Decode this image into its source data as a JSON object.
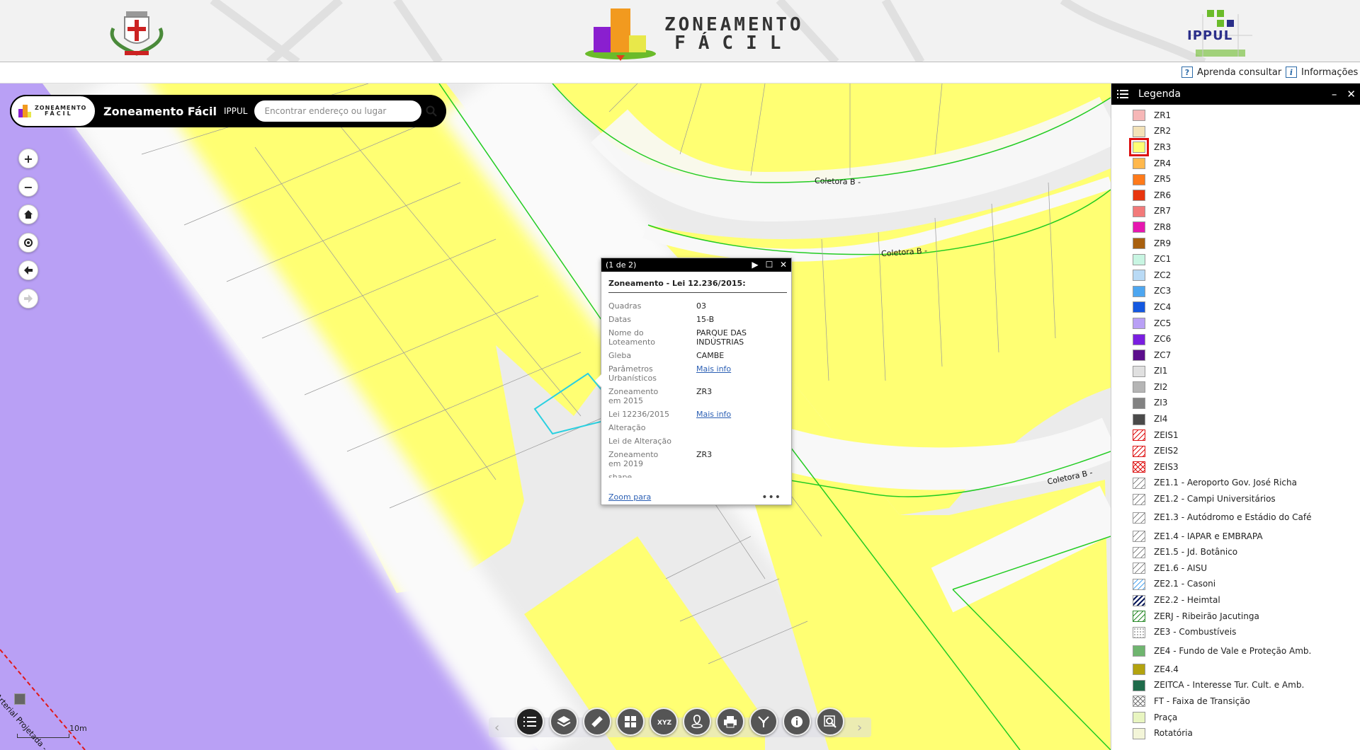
{
  "banner": {
    "title_line1": "ZONEAMENTO",
    "title_line2": "FÁCIL",
    "logo_right": "IPPUL"
  },
  "toolbar": {
    "learn_label": "Aprenda consultar",
    "info_label": "Informações"
  },
  "searchbar": {
    "logo_line1": "ZONEAMENTO",
    "logo_line2": "FÁCIL",
    "title": "Zoneamento Fácil",
    "subtitle": "IPPUL",
    "placeholder": "Encontrar endereço ou lugar"
  },
  "map": {
    "road_labels": [
      "Coletora B -",
      "Coletora B -",
      "Coletora B -",
      "Arterial Projetada -"
    ],
    "scale_label": "10m"
  },
  "popup": {
    "counter": "(1 de 2)",
    "title": "Zoneamento - Lei 12.236/2015:",
    "rows": [
      {
        "key": "Quadras",
        "value": "03"
      },
      {
        "key": "Datas",
        "value": "15-B"
      },
      {
        "key": "Nome do Loteamento",
        "value": "PARQUE DAS INDÚSTRIAS"
      },
      {
        "key": "Gleba",
        "value": "CAMBE"
      },
      {
        "key": "Parâmetros Urbanísticos",
        "value": "Mais info"
      },
      {
        "key": "Zoneamento em 2015",
        "value": "ZR3"
      },
      {
        "key": "Lei 12236/2015",
        "value": "Mais info"
      },
      {
        "key": "Alteração",
        "value": ""
      },
      {
        "key": "Lei de Alteração",
        "value": ""
      },
      {
        "key": "Zoneamento em 2019",
        "value": "ZR3"
      },
      {
        "key": "shape",
        "value": ""
      }
    ],
    "zoom_label": "Zoom para",
    "more": "•••"
  },
  "legend": {
    "title": "Legenda",
    "items": [
      {
        "label": "ZR1",
        "color": "#f6b7b7"
      },
      {
        "label": "ZR2",
        "color": "#f3e2b8"
      },
      {
        "label": "ZR3",
        "color": "#ffff73"
      },
      {
        "label": "ZR4",
        "color": "#ffb84d"
      },
      {
        "label": "ZR5",
        "color": "#ff7a1a"
      },
      {
        "label": "ZR6",
        "color": "#e8350e"
      },
      {
        "label": "ZR7",
        "color": "#f27a7a"
      },
      {
        "label": "ZR8",
        "color": "#e617b0"
      },
      {
        "label": "ZR9",
        "color": "#a8600f"
      },
      {
        "label": "ZC1",
        "color": "#c8f5e2"
      },
      {
        "label": "ZC2",
        "color": "#b9daf5"
      },
      {
        "label": "ZC3",
        "color": "#4da6f0"
      },
      {
        "label": "ZC4",
        "color": "#1458e0"
      },
      {
        "label": "ZC5",
        "color": "#b9a0f5"
      },
      {
        "label": "ZC6",
        "color": "#7a1ee0"
      },
      {
        "label": "ZC7",
        "color": "#5c0e8c"
      },
      {
        "label": "ZI1",
        "color": "#e0e0e0"
      },
      {
        "label": "ZI2",
        "color": "#b5b5b5"
      },
      {
        "label": "ZI3",
        "color": "#828282"
      },
      {
        "label": "ZI4",
        "color": "#4a4a4a"
      },
      {
        "label": "ZEIS1",
        "color": "hatch-red"
      },
      {
        "label": "ZEIS2",
        "color": "hatch-red"
      },
      {
        "label": "ZEIS3",
        "color": "hatch-red-cross"
      },
      {
        "label": "ZE1.1 - Aeroporto Gov. José Richa",
        "color": "hatch-grey"
      },
      {
        "label": "ZE1.2 - Campi Universitários",
        "color": "hatch-grey"
      },
      {
        "label": "ZE1.3 - Autódromo e Estádio do Café",
        "color": "hatch-grey"
      },
      {
        "label": "ZE1.4 - IAPAR e EMBRAPA",
        "color": "hatch-grey"
      },
      {
        "label": "ZE1.5 - Jd. Botânico",
        "color": "hatch-grey"
      },
      {
        "label": "ZE1.6 - AISU",
        "color": "hatch-grey"
      },
      {
        "label": "ZE2.1 - Casoni",
        "color": "hatch-blue"
      },
      {
        "label": "ZE2.2 - Heimtal",
        "color": "hatch-navy"
      },
      {
        "label": "ZERJ - Ribeirão Jacutinga",
        "color": "hatch-green"
      },
      {
        "label": "ZE3 - Combustíveis",
        "color": "dots"
      },
      {
        "label": "ZE4 - Fundo de Vale e Proteção Amb.",
        "color": "#6fb56f"
      },
      {
        "label": "ZE4.4",
        "color": "#b3a30f"
      },
      {
        "label": "ZEITCA - Interesse Tur. Cult. e Amb.",
        "color": "#1f6b4a"
      },
      {
        "label": "FT - Faixa de Transição",
        "color": "hatch-cross"
      },
      {
        "label": "Praça",
        "color": "#e8f5c0"
      },
      {
        "label": "Rotatória",
        "color": "#f3f5d8"
      }
    ],
    "selected": "ZR3"
  },
  "bottom_tools": [
    "list-icon",
    "layers-icon",
    "ruler-icon",
    "grid-icon",
    "xyz-icon",
    "location-pin-icon",
    "print-icon",
    "share-icon",
    "info-icon",
    "search-zoom-icon"
  ]
}
